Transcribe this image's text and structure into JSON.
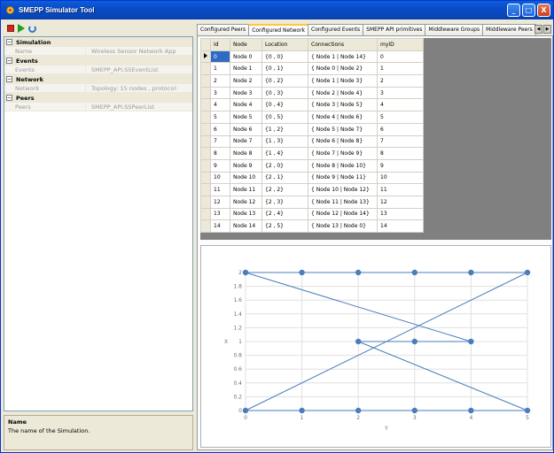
{
  "window": {
    "title": "SMEPP Simulator Tool"
  },
  "window_buttons": {
    "minimize": "_",
    "maximize": "□",
    "close": "X"
  },
  "property_grid": {
    "categories": [
      {
        "name": "Simulation",
        "rows": [
          {
            "name": "Name",
            "value": "Wireless Sensor Network App"
          }
        ]
      },
      {
        "name": "Events",
        "rows": [
          {
            "name": "Events",
            "value": "SMEPP_API.SSEventList"
          }
        ]
      },
      {
        "name": "Network",
        "rows": [
          {
            "name": "Network",
            "value": "Topology: 15 nodes , protocol:"
          }
        ]
      },
      {
        "name": "Peers",
        "rows": [
          {
            "name": "Peers",
            "value": "SMEPP_API.SSPeerList"
          }
        ]
      }
    ]
  },
  "description": {
    "title": "Name",
    "text": "The name of the Simulation."
  },
  "tabs": [
    "Configured Peers",
    "Configured Network",
    "Configured Events",
    "SMEPP API primitives",
    "Middleware Groups",
    "Middleware Peers"
  ],
  "active_tab": 1,
  "grid": {
    "columns": [
      "Id",
      "Node",
      "Location",
      "Connections",
      "myID"
    ],
    "rows": [
      [
        "0",
        "Node 0",
        "{0 , 0}",
        "{ Node 1 | Node 14}",
        "0"
      ],
      [
        "1",
        "Node 1",
        "{0 , 1}",
        "{ Node 0 | Node 2}",
        "1"
      ],
      [
        "2",
        "Node 2",
        "{0 , 2}",
        "{ Node 1 | Node 3}",
        "2"
      ],
      [
        "3",
        "Node 3",
        "{0 , 3}",
        "{ Node 2 | Node 4}",
        "3"
      ],
      [
        "4",
        "Node 4",
        "{0 , 4}",
        "{ Node 3 | Node 5}",
        "4"
      ],
      [
        "5",
        "Node 5",
        "{0 , 5}",
        "{ Node 4 | Node 6}",
        "5"
      ],
      [
        "6",
        "Node 6",
        "{1 , 2}",
        "{ Node 5 | Node 7}",
        "6"
      ],
      [
        "7",
        "Node 7",
        "{1 , 3}",
        "{ Node 6 | Node 8}",
        "7"
      ],
      [
        "8",
        "Node 8",
        "{1 , 4}",
        "{ Node 7 | Node 9}",
        "8"
      ],
      [
        "9",
        "Node 9",
        "{2 , 0}",
        "{ Node 8 | Node 10}",
        "9"
      ],
      [
        "10",
        "Node 10",
        "{2 , 1}",
        "{ Node 9 | Node 11}",
        "10"
      ],
      [
        "11",
        "Node 11",
        "{2 , 2}",
        "{ Node 10 | Node 12}",
        "11"
      ],
      [
        "12",
        "Node 12",
        "{2 , 3}",
        "{ Node 11 | Node 13}",
        "12"
      ],
      [
        "13",
        "Node 13",
        "{2 , 4}",
        "{ Node 12 | Node 14}",
        "13"
      ],
      [
        "14",
        "Node 14",
        "{2 , 5}",
        "{ Node 13 | Node 0}",
        "14"
      ]
    ]
  },
  "chart_data": {
    "type": "line",
    "xlabel": "Y",
    "ylabel": "X",
    "xlim": [
      0,
      5
    ],
    "ylim": [
      0,
      2
    ],
    "xticks": [
      "0",
      "1",
      "2",
      "3",
      "4",
      "5"
    ],
    "yticks": [
      "0",
      "0.2",
      "0.4",
      "0.6",
      "0.8",
      "1",
      "1.2",
      "1.4",
      "1.6",
      "1.8",
      "2"
    ],
    "grid": true,
    "points": [
      [
        0,
        0
      ],
      [
        1,
        0
      ],
      [
        2,
        0
      ],
      [
        3,
        0
      ],
      [
        4,
        0
      ],
      [
        5,
        0
      ],
      [
        2,
        1
      ],
      [
        3,
        1
      ],
      [
        4,
        1
      ],
      [
        0,
        2
      ],
      [
        1,
        2
      ],
      [
        2,
        2
      ],
      [
        3,
        2
      ],
      [
        4,
        2
      ],
      [
        5,
        2
      ]
    ],
    "color": "#4a7ebb"
  }
}
